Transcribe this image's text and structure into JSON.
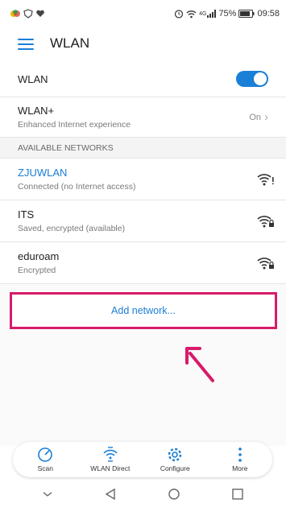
{
  "status_bar": {
    "battery": "75%",
    "time": "09:58",
    "network": "4G"
  },
  "app_bar": {
    "title": "WLAN"
  },
  "wlan_row": {
    "label": "WLAN",
    "enabled": true
  },
  "wlan_plus_row": {
    "title": "WLAN+",
    "subtitle": "Enhanced Internet experience",
    "value": "On"
  },
  "section_header": "AVAILABLE NETWORKS",
  "networks": [
    {
      "name": "ZJUWLAN",
      "status": "Connected (no Internet access)",
      "icon": "wifi-warning-icon"
    },
    {
      "name": "ITS",
      "status": "Saved, encrypted (available)",
      "icon": "wifi-lock-icon"
    },
    {
      "name": "eduroam",
      "status": "Encrypted",
      "icon": "wifi-lock-icon"
    }
  ],
  "add_network": "Add network...",
  "bottom_bar": [
    {
      "label": "Scan",
      "icon": "scan-icon"
    },
    {
      "label": "WLAN Direct",
      "icon": "wlan-direct-icon"
    },
    {
      "label": "Configure",
      "icon": "gear-icon"
    },
    {
      "label": "More",
      "icon": "more-icon"
    }
  ],
  "colors": {
    "accent": "#1a7fd6",
    "highlight": "#d81b6a"
  }
}
